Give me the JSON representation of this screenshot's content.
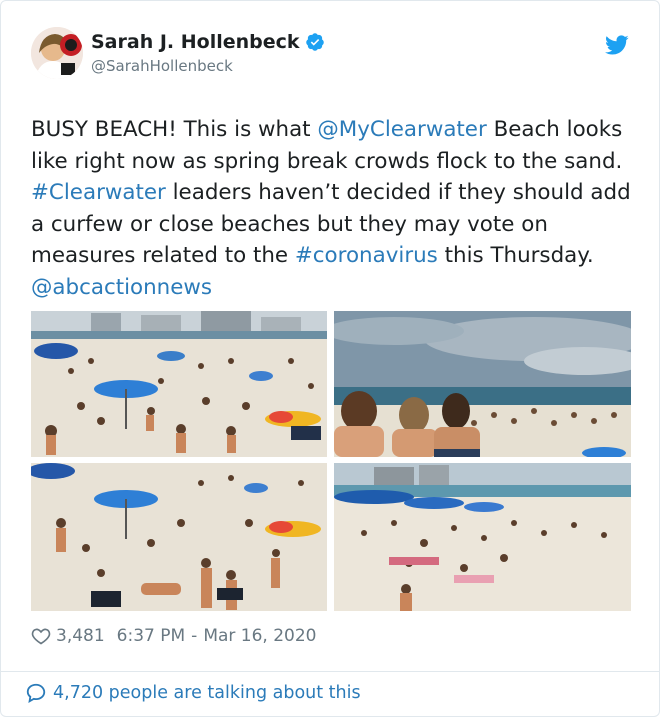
{
  "author": {
    "display_name": "Sarah J. Hollenbeck",
    "handle": "@SarahHollenbeck"
  },
  "icons": {
    "avatar": "avatar-photo",
    "verified": "verified-badge-icon",
    "brand": "twitter-bird-icon",
    "like": "heart-icon",
    "conversation": "speech-bubble-icon"
  },
  "tweet": {
    "segments": [
      {
        "text": "BUSY BEACH! This is what ",
        "type": "text"
      },
      {
        "text": "@MyClearwater",
        "type": "link"
      },
      {
        "text": " Beach looks like right now as spring break crowds flock to the sand. ",
        "type": "text"
      },
      {
        "text": "#Clearwater",
        "type": "link"
      },
      {
        "text": " leaders haven’t decided if they should add a curfew or close beaches but they may vote on measures related to the ",
        "type": "text"
      },
      {
        "text": "#coronavirus",
        "type": "link"
      },
      {
        "text": " this Thursday. ",
        "type": "text"
      },
      {
        "text": "@abcactionnews",
        "type": "link"
      }
    ]
  },
  "media": {
    "photos": [
      {
        "name": "beach-photo-1",
        "subject": "crowded beach with umbrellas"
      },
      {
        "name": "beach-photo-2",
        "subject": "three women on beach shoreline"
      },
      {
        "name": "beach-photo-3",
        "subject": "crowded beach with umbrellas"
      },
      {
        "name": "beach-photo-4",
        "subject": "wide view of beach with blue tents"
      }
    ]
  },
  "stats": {
    "likes": "3,481",
    "time": "6:37 PM",
    "separator": "-",
    "date": "Mar 16, 2020"
  },
  "footer": {
    "conversation_label": "4,720 people are talking about this"
  },
  "colors": {
    "link": "#2b7bb9",
    "verified": "#1da1f2",
    "muted": "#697882",
    "text": "#1c2022",
    "border": "#e1e8ed"
  }
}
